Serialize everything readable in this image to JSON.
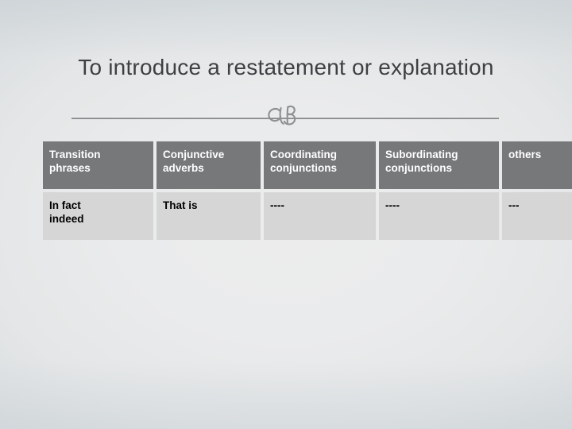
{
  "slide": {
    "title": "To introduce a restatement or explanation",
    "ornament_name": "cb-ornament",
    "colors": {
      "background_light": "#ececec",
      "background_edge": "#d5dadc",
      "title_text": "#3f4041",
      "divider": "#8e9091",
      "table_header_bg": "#76787a",
      "table_header_text": "#ffffff",
      "table_cell_bg": "#d6d6d6",
      "table_cell_text": "#000000"
    }
  },
  "table": {
    "headers": [
      "Transition phrases",
      "Conjunctive adverbs",
      "Coordinating conjunctions",
      "Subordinating conjunctions",
      "others"
    ],
    "header_lines": [
      [
        "Transition",
        "phrases"
      ],
      [
        "Conjunctive",
        "adverbs"
      ],
      [
        "Coordinating",
        "conjunctions"
      ],
      [
        "Subordinating",
        "conjunctions"
      ],
      [
        "others",
        ""
      ]
    ],
    "rows": [
      {
        "cells": [
          {
            "lines": [
              "In fact",
              "indeed"
            ]
          },
          {
            "lines": [
              "That is",
              ""
            ]
          },
          {
            "lines": [
              "----",
              ""
            ]
          },
          {
            "lines": [
              "----",
              ""
            ]
          },
          {
            "lines": [
              "---",
              ""
            ]
          }
        ]
      }
    ]
  }
}
